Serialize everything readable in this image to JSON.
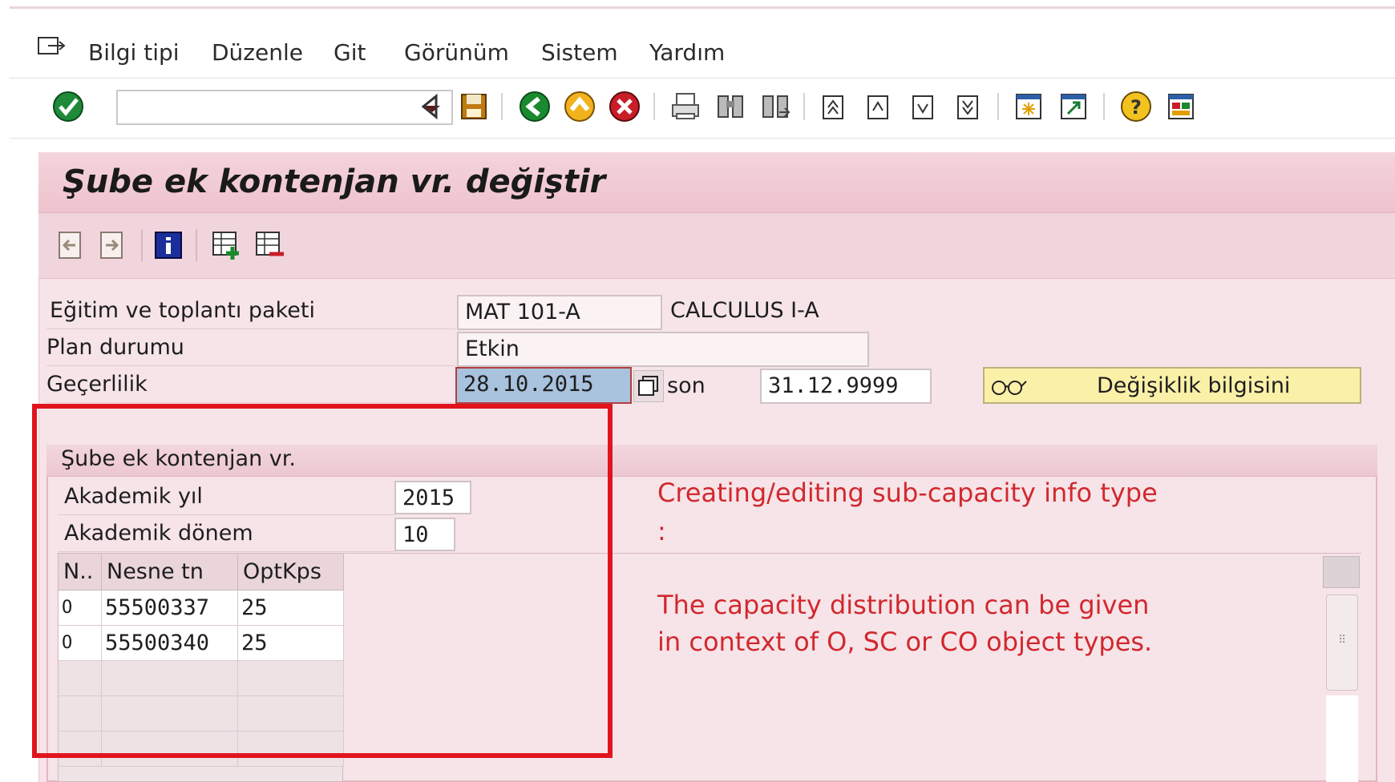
{
  "menu": {
    "items": [
      "Bilgi tipi",
      "Düzenle",
      "Git",
      "Görünüm",
      "Sistem",
      "Yardım"
    ]
  },
  "toolbar": {
    "command_field_value": "",
    "icons": [
      "enter-icon",
      "back-arrow-icon",
      "save-icon",
      "back-icon",
      "exit-icon",
      "cancel-icon",
      "print-icon",
      "find-icon",
      "find-next-icon",
      "first-page-icon",
      "previous-page-icon",
      "next-page-icon",
      "last-page-icon",
      "new-session-icon",
      "shortcut-icon",
      "help-icon",
      "customize-layout-icon"
    ]
  },
  "screen": {
    "title": "Şube ek kontenjan vr. değiştir",
    "app_icons": [
      "previous-record-icon",
      "next-record-icon",
      "info-icon",
      "insert-row-icon",
      "delete-row-icon"
    ]
  },
  "header_fields": {
    "package_label": "Eğitim ve toplantı paketi",
    "package_code": "MAT 101-A",
    "package_name": "CALCULUS I-A",
    "plan_status_label": "Plan durumu",
    "plan_status_value": "Etkin",
    "validity_label": "Geçerlilik",
    "validity_start": "28.10.2015",
    "validity_to_label": "son",
    "validity_end": "31.12.9999",
    "change_info_button": "Değişiklik bilgisini"
  },
  "subscreen": {
    "group_title": "Şube ek kontenjan vr.",
    "academic_year_label": "Akademik yıl",
    "academic_year_value": "2015",
    "academic_term_label": "Akademik dönem",
    "academic_term_value": "10",
    "table": {
      "columns": [
        "N..",
        "Nesne tn",
        "OptKps"
      ],
      "rows": [
        {
          "type": "O",
          "object_id": "55500337",
          "capacity": "25"
        },
        {
          "type": "O",
          "object_id": "55500340",
          "capacity": "25"
        }
      ]
    }
  },
  "annotations": {
    "line1": "Creating/editing sub-capacity info type",
    "line2": ":",
    "line3": "The capacity distribution can be given",
    "line4": "in context of O, SC or CO object types."
  },
  "colors": {
    "annotation_red": "#d2282e",
    "frame_red": "#e1141e",
    "screen_pink": "#f6e4e8",
    "button_yellow": "#fbf0a8"
  }
}
